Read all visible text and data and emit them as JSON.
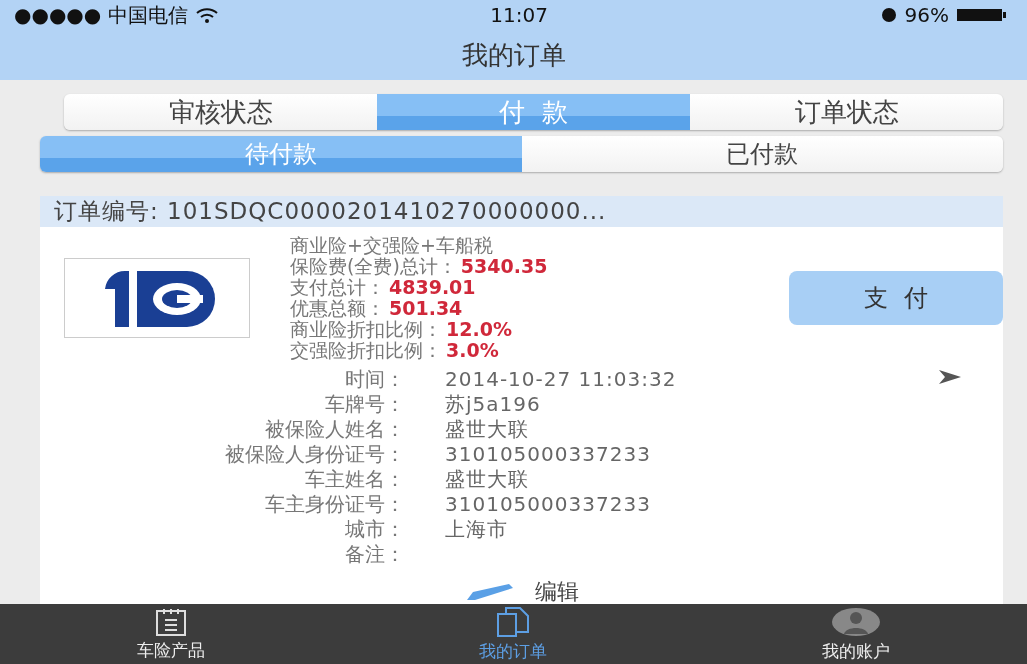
{
  "status_bar": {
    "carrier": "●●●●● 中国电信",
    "time": "11:07",
    "battery": "96%"
  },
  "nav_bar": {
    "title": "我的订单"
  },
  "tabs": [
    {
      "label": "审核状态",
      "selected": false
    },
    {
      "label": "付  款",
      "selected": true
    },
    {
      "label": "订单状态",
      "selected": false
    }
  ],
  "sub_tabs": [
    {
      "label": "待付款",
      "selected": true
    },
    {
      "label": "已付款",
      "selected": false
    }
  ],
  "order": {
    "number": "订单编号: 101SDQC0000201410270000000...",
    "summary": [
      {
        "label": "商业险+交强险+车船税"
      },
      {
        "label": "保险费(全费)总计：",
        "value": "5340.35"
      },
      {
        "label": "支付总计：",
        "value": "4839.01"
      },
      {
        "label": "优惠总额：",
        "value": "501.34"
      },
      {
        "label": "商业险折扣比例：",
        "value": "12.0%"
      },
      {
        "label": "交强险折扣比例：",
        "value": "3.0%"
      }
    ],
    "pay_button": "支  付",
    "details": [
      {
        "label": "时间：",
        "value": "2014-10-27 11:03:32"
      },
      {
        "label": "车牌号：",
        "value": "苏j5a196"
      },
      {
        "label": "被保险人姓名：",
        "value": "盛世大联"
      },
      {
        "label": "被保险人身份证号：",
        "value": "310105000337233"
      },
      {
        "label": "车主姓名：",
        "value": "盛世大联"
      },
      {
        "label": "车主身份证号：",
        "value": "310105000337233"
      },
      {
        "label": "城市：",
        "value": "上海市"
      },
      {
        "label": "备注："
      }
    ],
    "edit_button": "编辑"
  },
  "tab_bar": [
    {
      "label": "车险产品",
      "kind": "calendar",
      "selected": false
    },
    {
      "label": "我的订单",
      "kind": "pages",
      "selected": true
    },
    {
      "label": "我的账户",
      "kind": "person",
      "selected": false
    }
  ]
}
